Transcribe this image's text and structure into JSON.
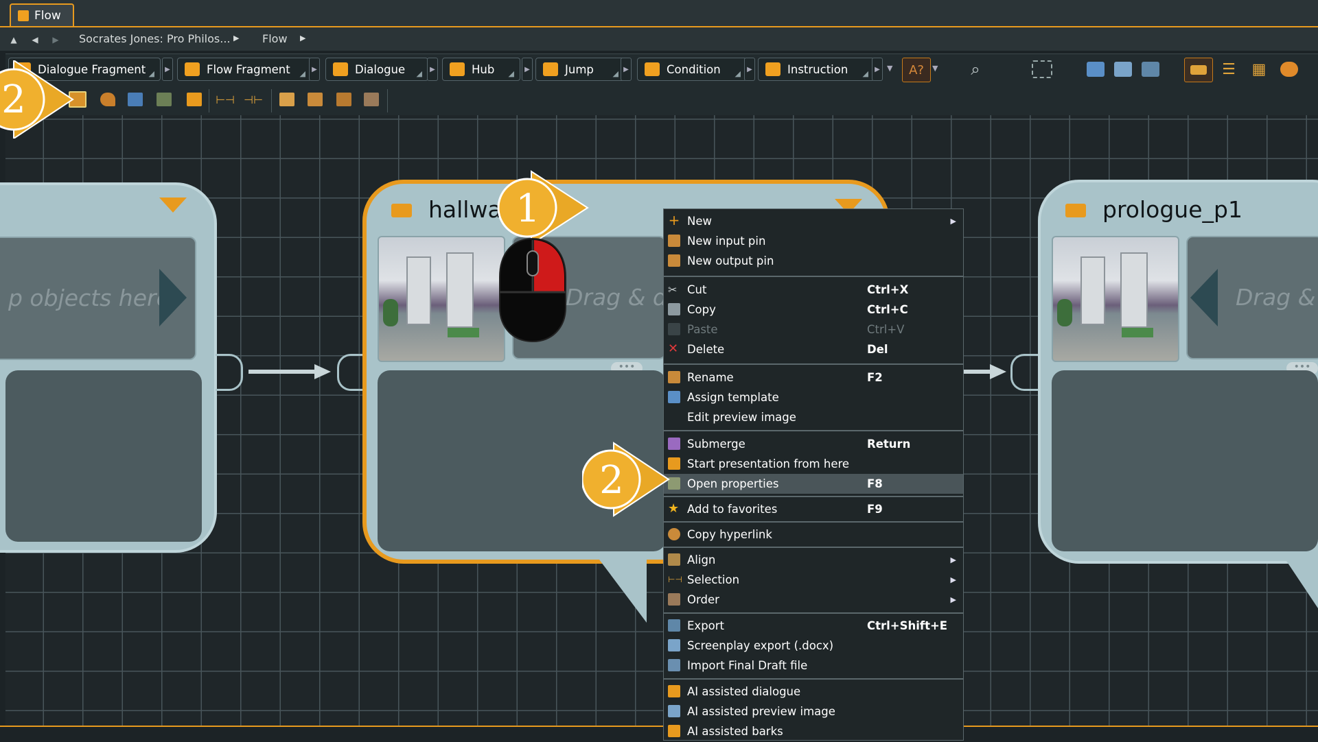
{
  "tab": {
    "label": "Flow"
  },
  "breadcrumb": {
    "project": "Socrates Jones: Pro Philos...",
    "current": "Flow"
  },
  "toolbar": {
    "tools": [
      "Dialogue Fragment",
      "Flow Fragment",
      "Dialogue",
      "Hub",
      "Jump",
      "Condition",
      "Instruction"
    ]
  },
  "nodes": {
    "left": {
      "hint": "p objects here"
    },
    "middle": {
      "title": "hallway",
      "hint": "Drag & d"
    },
    "right": {
      "title": "prologue_p1",
      "hint": "Drag &"
    }
  },
  "context_menu": {
    "items": [
      {
        "label": "New",
        "shortcut": "",
        "submenu": true
      },
      {
        "label": "New input pin",
        "shortcut": ""
      },
      {
        "label": "New output pin",
        "shortcut": ""
      },
      {
        "label": "Cut",
        "shortcut": "Ctrl+X"
      },
      {
        "label": "Copy",
        "shortcut": "Ctrl+C"
      },
      {
        "label": "Paste",
        "shortcut": "Ctrl+V",
        "disabled": true
      },
      {
        "label": "Delete",
        "shortcut": "Del"
      },
      {
        "label": "Rename",
        "shortcut": "F2"
      },
      {
        "label": "Assign template",
        "shortcut": ""
      },
      {
        "label": "Edit preview image",
        "shortcut": ""
      },
      {
        "label": "Submerge",
        "shortcut": "Return"
      },
      {
        "label": "Start presentation from here",
        "shortcut": ""
      },
      {
        "label": "Open properties",
        "shortcut": "F8",
        "highlighted": true
      },
      {
        "label": "Add to favorites",
        "shortcut": "F9"
      },
      {
        "label": "Copy hyperlink",
        "shortcut": ""
      },
      {
        "label": "Align",
        "shortcut": "",
        "submenu": true
      },
      {
        "label": "Selection",
        "shortcut": "",
        "submenu": true
      },
      {
        "label": "Order",
        "shortcut": "",
        "submenu": true
      },
      {
        "label": "Export",
        "shortcut": "Ctrl+Shift+E"
      },
      {
        "label": "Screenplay export (.docx)",
        "shortcut": ""
      },
      {
        "label": "Import Final Draft file",
        "shortcut": ""
      },
      {
        "label": "AI assisted dialogue",
        "shortcut": ""
      },
      {
        "label": "AI assisted preview image",
        "shortcut": ""
      },
      {
        "label": "AI assisted barks",
        "shortcut": ""
      }
    ]
  },
  "callouts": {
    "step1": "1",
    "step2_menu": "2",
    "step2_toolbar": "2"
  },
  "colors": {
    "accent": "#e89a1e",
    "node_fill": "#a9c3c9",
    "menu_bg": "#1f2628",
    "canvas": "#1f2629"
  }
}
